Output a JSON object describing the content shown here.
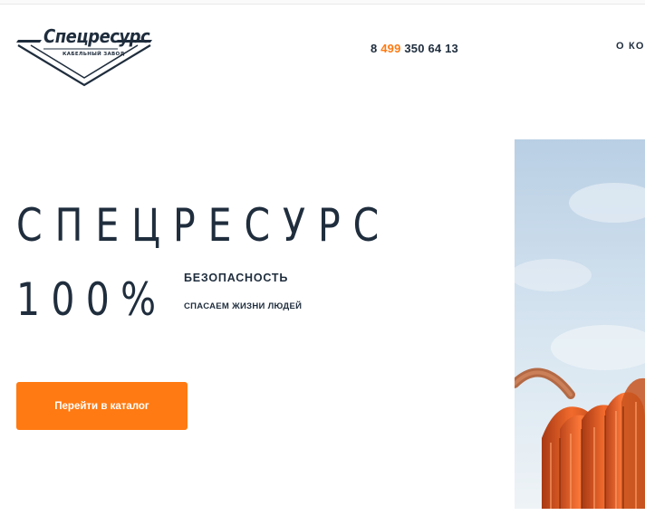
{
  "header": {
    "logo": {
      "title": "Спецресурс",
      "subtitle": "КАБЕЛЬНЫЙ ЗАВОД"
    },
    "phone": {
      "prefix": "8 ",
      "code": "499",
      "number": " 350 64 13"
    },
    "nav_about": "О КОМ"
  },
  "hero": {
    "title": "СПЕЦРЕСУРС",
    "percent": "100%",
    "safety": "БЕЗОПАСНОСТЬ",
    "slogan": "СПАСАЕМ ЖИЗНИ ЛЮДЕЙ",
    "catalog_button": "Перейти в каталог",
    "image": "orange-cable-coil-photo"
  },
  "colors": {
    "accent": "#ff7a12",
    "text": "#1f2d3d"
  }
}
